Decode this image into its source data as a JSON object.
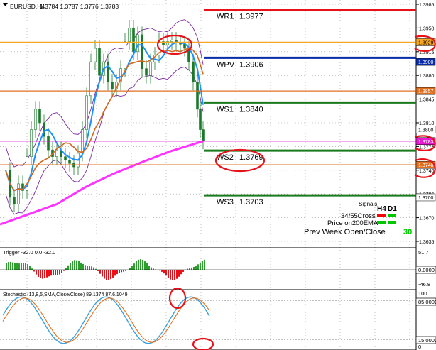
{
  "header": {
    "title": "EURUSD,H4",
    "ohlc": "1.3784 1.3787 1.3776 1.3783"
  },
  "levels": [
    {
      "name": "WR1",
      "value": "1.3977",
      "color": "#e8111a"
    },
    {
      "name": "WPV",
      "value": "1.3906",
      "color": "#0a2ca8"
    },
    {
      "name": "WS1",
      "value": "1.3840",
      "color": "#197a1e"
    },
    {
      "name": "WS2",
      "value": "1.3769",
      "color": "#197a1e"
    },
    {
      "name": "WS3",
      "value": "1.3703",
      "color": "#197a1e"
    }
  ],
  "price_axis": {
    "ticks": [
      "1.3985",
      "1.3950",
      "1.3915",
      "1.3880",
      "1.3845",
      "1.3810",
      "1.3775",
      "1.3740",
      "1.3705",
      "1.3670",
      "1.3635"
    ],
    "tags": [
      {
        "text": "1.3929",
        "bg": "#f5a623",
        "fg": "#000000"
      },
      {
        "text": "1.3900",
        "bg": "#0a2ca8",
        "fg": "#ffffff"
      },
      {
        "text": "1.3857",
        "bg": "#e07020",
        "fg": "#ffffff"
      },
      {
        "text": "1.3800",
        "bg": "#ffffff",
        "fg": "#000000"
      },
      {
        "text": "1.3783",
        "bg": "#e81ad0",
        "fg": "#ffffff"
      },
      {
        "text": "1.3748",
        "bg": "#e07020",
        "fg": "#ffffff"
      },
      {
        "text": "1.3700",
        "bg": "#ffffff",
        "fg": "#000000"
      }
    ]
  },
  "signals": {
    "title": "Signals",
    "tf1": "H4",
    "tf2": "D1",
    "row1": "34/55Cross",
    "row2": "Price on200EMA",
    "row3": "Prev Week Open/Close",
    "row3_value": "30",
    "color_red": "#ff0000",
    "color_green": "#00c800"
  },
  "trigger": {
    "label": "Trigger -32.0 0.0 -32.0",
    "ticks": [
      "51.7",
      "0.0000",
      "-46.8"
    ]
  },
  "stochastic": {
    "label": "Stochastic (13,8,5,SMA,Close/Close) 89.1374 87.6.1049",
    "ticks": [
      "100",
      "85.0000",
      "15.0000",
      "0"
    ]
  },
  "colors": {
    "ema_blue": "#1e90ff",
    "ema_orange": "#d2691e",
    "ema_magenta": "#ff33ff",
    "bands": "#7b2a9e",
    "candles": "#1b7a2a",
    "annotation": "#e8111a"
  }
}
